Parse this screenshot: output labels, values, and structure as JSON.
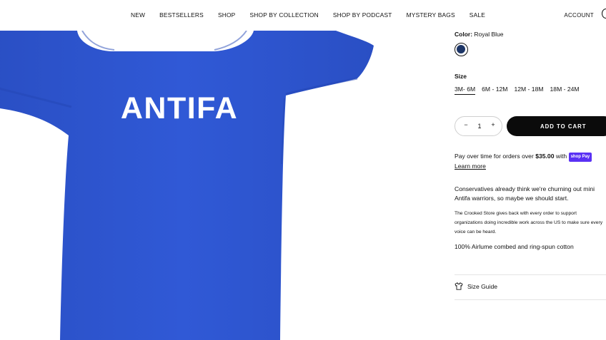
{
  "nav": {
    "links": [
      "NEW",
      "BESTSELLERS",
      "SHOP",
      "SHOP BY COLLECTION",
      "SHOP BY PODCAST",
      "MYSTERY BAGS",
      "SALE"
    ],
    "account": "ACCOUNT"
  },
  "product": {
    "shirt_text": "ANTIFA",
    "shirt_color": "#2f57d3"
  },
  "color": {
    "label": "Color:",
    "value": "Royal Blue",
    "swatch": "#1c3566"
  },
  "size": {
    "title": "Size",
    "options": [
      "3M- 6M",
      "6M - 12M",
      "12M - 18M",
      "18M - 24M"
    ],
    "selected": "3M- 6M"
  },
  "quantity": {
    "minus": "−",
    "value": "1",
    "plus": "+"
  },
  "add_to_cart": "ADD TO CART",
  "installments": {
    "text": "Pay over time for orders over",
    "amount": "$35.00",
    "with": "with",
    "badge": "shop Pay",
    "learn_more": "Learn more"
  },
  "description": {
    "p1": "Conservatives already think we're churning out mini Antifa warriors, so maybe we should start.",
    "p2": "The Crooked Store gives back with every order to support organizations doing incredible work across the US to make sure every voice can be heard.",
    "p3": "100% Airlume combed and ring-spun cotton"
  },
  "size_guide": "Size Guide"
}
